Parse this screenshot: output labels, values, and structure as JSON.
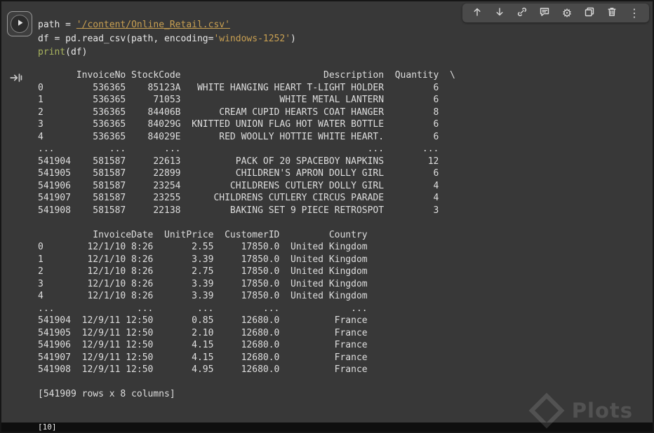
{
  "cell": {
    "code": {
      "line1_pre": "path = ",
      "line1_string": "'/content/Online_Retail.csv'",
      "line2_pre": "df = pd.read_csv(path, encoding=",
      "line2_string": "'windows-1252'",
      "line2_post": ")",
      "line3_builtin": "print",
      "line3_post": "(df)"
    },
    "output_text": "       InvoiceNo StockCode                          Description  Quantity  \\\n0         536365    85123A   WHITE HANGING HEART T-LIGHT HOLDER         6\n1         536365     71053                  WHITE METAL LANTERN         6\n2         536365    84406B       CREAM CUPID HEARTS COAT HANGER         8\n3         536365    84029G  KNITTED UNION FLAG HOT WATER BOTTLE         6\n4         536365    84029E       RED WOOLLY HOTTIE WHITE HEART.         6\n...          ...       ...                                  ...       ...\n541904    581587     22613          PACK OF 20 SPACEBOY NAPKINS        12\n541905    581587     22899          CHILDREN'S APRON DOLLY GIRL         6\n541906    581587     23254         CHILDRENS CUTLERY DOLLY GIRL         4\n541907    581587     23255      CHILDRENS CUTLERY CIRCUS PARADE         4\n541908    581587     22138         BAKING SET 9 PIECE RETROSPOT         3\n\n          InvoiceDate  UnitPrice  CustomerID         Country\n0        12/1/10 8:26       2.55     17850.0  United Kingdom\n1        12/1/10 8:26       3.39     17850.0  United Kingdom\n2        12/1/10 8:26       2.75     17850.0  United Kingdom\n3        12/1/10 8:26       3.39     17850.0  United Kingdom\n4        12/1/10 8:26       3.39     17850.0  United Kingdom\n...               ...        ...         ...             ...\n541904  12/9/11 12:50       0.85     12680.0          France\n541905  12/9/11 12:50       2.10     12680.0          France\n541906  12/9/11 12:50       4.15     12680.0          France\n541907  12/9/11 12:50       4.15     12680.0          France\n541908  12/9/11 12:50       4.95     12680.0          France\n\n[541909 rows x 8 columns]"
  },
  "toolbar": {
    "icons": [
      "move-cell-up",
      "move-cell-down",
      "copy-cell-link",
      "add-comment",
      "cell-settings",
      "mirror-cell",
      "delete-cell",
      "more-actions"
    ],
    "gear_glyph": "⚙",
    "more_glyph": "⋮"
  },
  "next_cell": {
    "execution_label": "[10]"
  },
  "watermark": {
    "text": "Plots"
  },
  "colors": {
    "background": "#383838",
    "toolbar_background": "#4a4a4a",
    "string_token": "#c9a052",
    "builtin_token": "#a9b45e",
    "code_text": "#e8e8e8",
    "output_text": "#dedede"
  }
}
